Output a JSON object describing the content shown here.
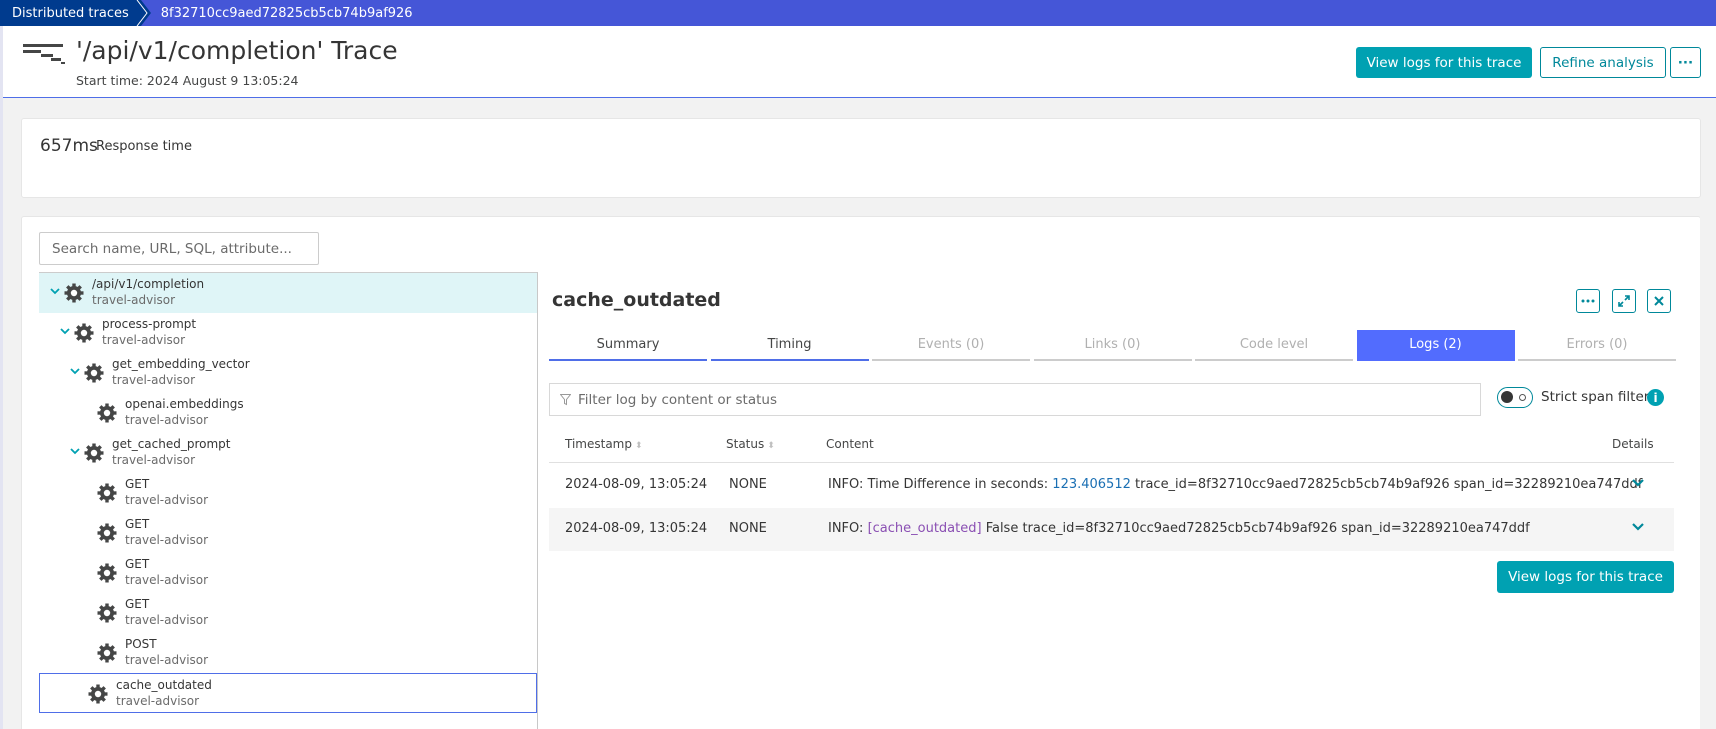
{
  "breadcrumb": {
    "root": "Distributed traces",
    "trace_id": "8f32710cc9aed72825cb5cb74b9af926"
  },
  "header": {
    "icon": "waterfall-icon",
    "title": "'/api/v1/completion' Trace",
    "start_time": "Start time: 2024 August 9 13:05:24",
    "view_logs_label": "View logs for this trace",
    "refine_label": "Refine analysis",
    "more_label": "···"
  },
  "response": {
    "value": "657ms",
    "label": "Response time"
  },
  "search": {
    "placeholder": "Search name, URL, SQL, attribute..."
  },
  "tree": [
    {
      "name": "/api/v1/completion",
      "service": "travel-advisor",
      "depth": 0,
      "expandable": true,
      "state": "root-selected"
    },
    {
      "name": "process-prompt",
      "service": "travel-advisor",
      "depth": 1,
      "expandable": true
    },
    {
      "name": "get_embedding_vector",
      "service": "travel-advisor",
      "depth": 2,
      "expandable": true
    },
    {
      "name": "openai.embeddings",
      "service": "travel-advisor",
      "depth": 3,
      "expandable": false
    },
    {
      "name": "get_cached_prompt",
      "service": "travel-advisor",
      "depth": 2,
      "expandable": true
    },
    {
      "name": "GET",
      "service": "travel-advisor",
      "depth": 3,
      "expandable": false
    },
    {
      "name": "GET",
      "service": "travel-advisor",
      "depth": 3,
      "expandable": false
    },
    {
      "name": "GET",
      "service": "travel-advisor",
      "depth": 3,
      "expandable": false
    },
    {
      "name": "GET",
      "service": "travel-advisor",
      "depth": 3,
      "expandable": false
    },
    {
      "name": "POST",
      "service": "travel-advisor",
      "depth": 3,
      "expandable": false
    },
    {
      "name": "cache_outdated",
      "service": "travel-advisor",
      "depth": 2,
      "expandable": false,
      "state": "active"
    }
  ],
  "detail": {
    "title": "cache_outdated",
    "tabs": [
      {
        "label": "Summary",
        "state": "done"
      },
      {
        "label": "Timing",
        "state": "done"
      },
      {
        "label": "Events (0)",
        "state": "disabled"
      },
      {
        "label": "Links (0)",
        "state": "disabled"
      },
      {
        "label": "Code level",
        "state": "disabled"
      },
      {
        "label": "Logs (2)",
        "state": "selected"
      },
      {
        "label": "Errors (0)",
        "state": "disabled"
      }
    ],
    "filter_placeholder": "Filter log by content or status",
    "strict_span_filter": {
      "label": "Strict span filter",
      "enabled": false
    },
    "columns": [
      "Timestamp",
      "Status",
      "Content",
      "Details"
    ],
    "logs": [
      {
        "timestamp": "2024-08-09, 13:05:24",
        "status": "NONE",
        "content_prefix": "INFO: Time Difference in seconds: ",
        "content_highlight": "123.406512",
        "content_suffix": " trace_id=8f32710cc9aed72825cb5cb74b9af926 span_id=32289210ea747ddf"
      },
      {
        "timestamp": "2024-08-09, 13:05:24",
        "status": "NONE",
        "content_prefix": "INFO: ",
        "content_highlight": "[cache_outdated]",
        "content_suffix": " False trace_id=8f32710cc9aed72825cb5cb74b9af926 span_id=32289210ea747ddf"
      }
    ],
    "view_logs_label": "View logs for this trace"
  },
  "colors": {
    "topbar": "#4556d7",
    "breadcrumb_root": "#003b8e",
    "primary_button": "#00a1b2",
    "selected_tab": "#526cfe",
    "selected_row": "#dff5f7",
    "number_highlight": "#1a6fb3",
    "tag_highlight": "#8a4fb3"
  }
}
